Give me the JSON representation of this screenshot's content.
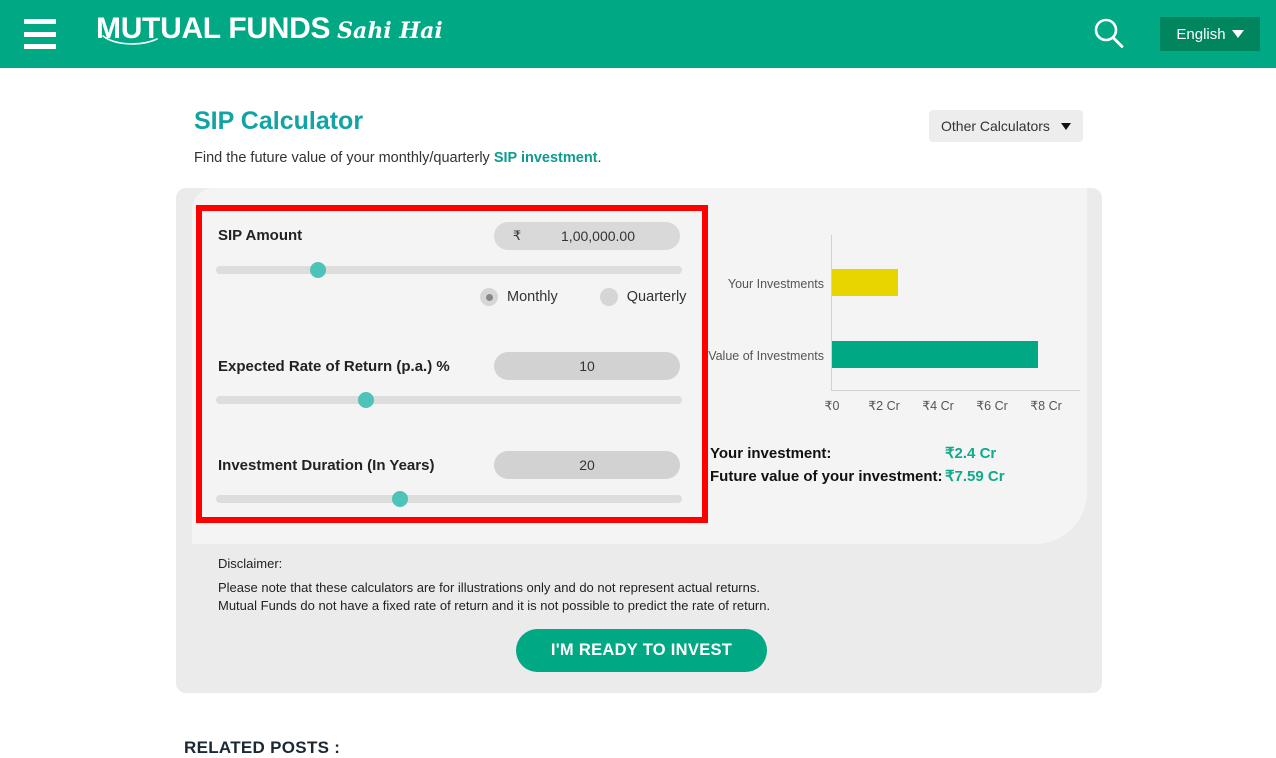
{
  "header": {
    "menu_icon": "hamburger-menu-icon",
    "brand_main": "MUTUAL FUNDS",
    "brand_script": "Sahi Hai",
    "search_icon": "search-icon",
    "language": "English"
  },
  "page": {
    "title": "SIP Calculator",
    "subtitle_before": "Find the future value of your monthly/quarterly ",
    "subtitle_link": "SIP investment",
    "subtitle_after": ".",
    "other_calculators": "Other Calculators"
  },
  "form": {
    "sip_amount": {
      "label": "SIP Amount",
      "currency_symbol": "₹",
      "value": "1,00,000.00",
      "slider_percent": 22
    },
    "frequency": {
      "options": [
        {
          "label": "Monthly",
          "selected": true
        },
        {
          "label": "Quarterly",
          "selected": false
        }
      ]
    },
    "rate_of_return": {
      "label": "Expected Rate of Return (p.a.) %",
      "value": "10",
      "slider_percent": 32
    },
    "duration": {
      "label": "Investment Duration (In Years)",
      "value": "20",
      "slider_percent": 39.5
    }
  },
  "chart_data": {
    "type": "bar",
    "orientation": "horizontal",
    "categories": [
      "Your Investments",
      "Value of Investments"
    ],
    "values": [
      2.4,
      7.59
    ],
    "colors": [
      "#e8d500",
      "#00a884"
    ],
    "title": "",
    "xlabel": "",
    "ylabel": "",
    "xlim": [
      0,
      8
    ],
    "xticks": [
      0,
      2,
      4,
      6,
      8
    ],
    "xtick_labels": [
      "₹0",
      "₹2 Cr",
      "₹4 Cr",
      "₹6 Cr",
      "₹8 Cr"
    ],
    "unit": "Cr",
    "grid": false,
    "legend": "none"
  },
  "results": {
    "invested_label": "Your investment:",
    "invested_value": "₹2.4 Cr",
    "future_label": "Future value of your investment:",
    "future_value": "₹7.59 Cr"
  },
  "disclaimer": {
    "title": "Disclaimer:",
    "line1": "Please note that these calculators are for illustrations only and do not represent actual returns.",
    "line2": "Mutual Funds do not have a fixed rate of return and it is not possible to predict the rate of return."
  },
  "cta": {
    "label": "I'M READY TO INVEST"
  },
  "related": {
    "heading": "RELATED POSTS :"
  },
  "colors": {
    "brand_green": "#00a884",
    "lang_green": "#00855f",
    "title_teal": "#13a3a3",
    "accent_teal": "#0faa8c",
    "bar_yellow": "#e8d500",
    "thumb_teal": "#4ec3b8",
    "annotation_red": "#ff0000"
  }
}
